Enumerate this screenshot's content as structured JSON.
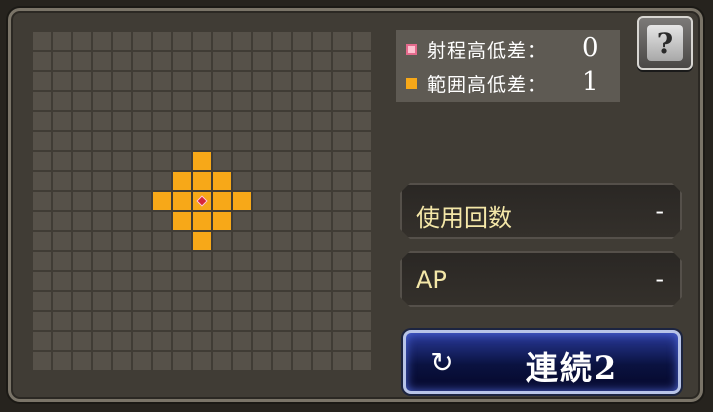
{
  "legend": {
    "range_height_label": "射程高低差：",
    "range_height_value": "0",
    "area_height_label": "範囲高低差：",
    "area_height_value": "1",
    "colors": {
      "range": "#e46a8c",
      "area": "#f7a818"
    }
  },
  "help_button": {
    "label": "?"
  },
  "stats": {
    "uses_label": "使用回数",
    "uses_value": "-",
    "ap_label": "AP",
    "ap_value": "-"
  },
  "chain_button": {
    "icon": "cycle-icon",
    "label": "連続2"
  },
  "grid": {
    "columns": 17,
    "rows": 17,
    "center": [
      8,
      8
    ],
    "highlight_color": "#f7a818"
  }
}
